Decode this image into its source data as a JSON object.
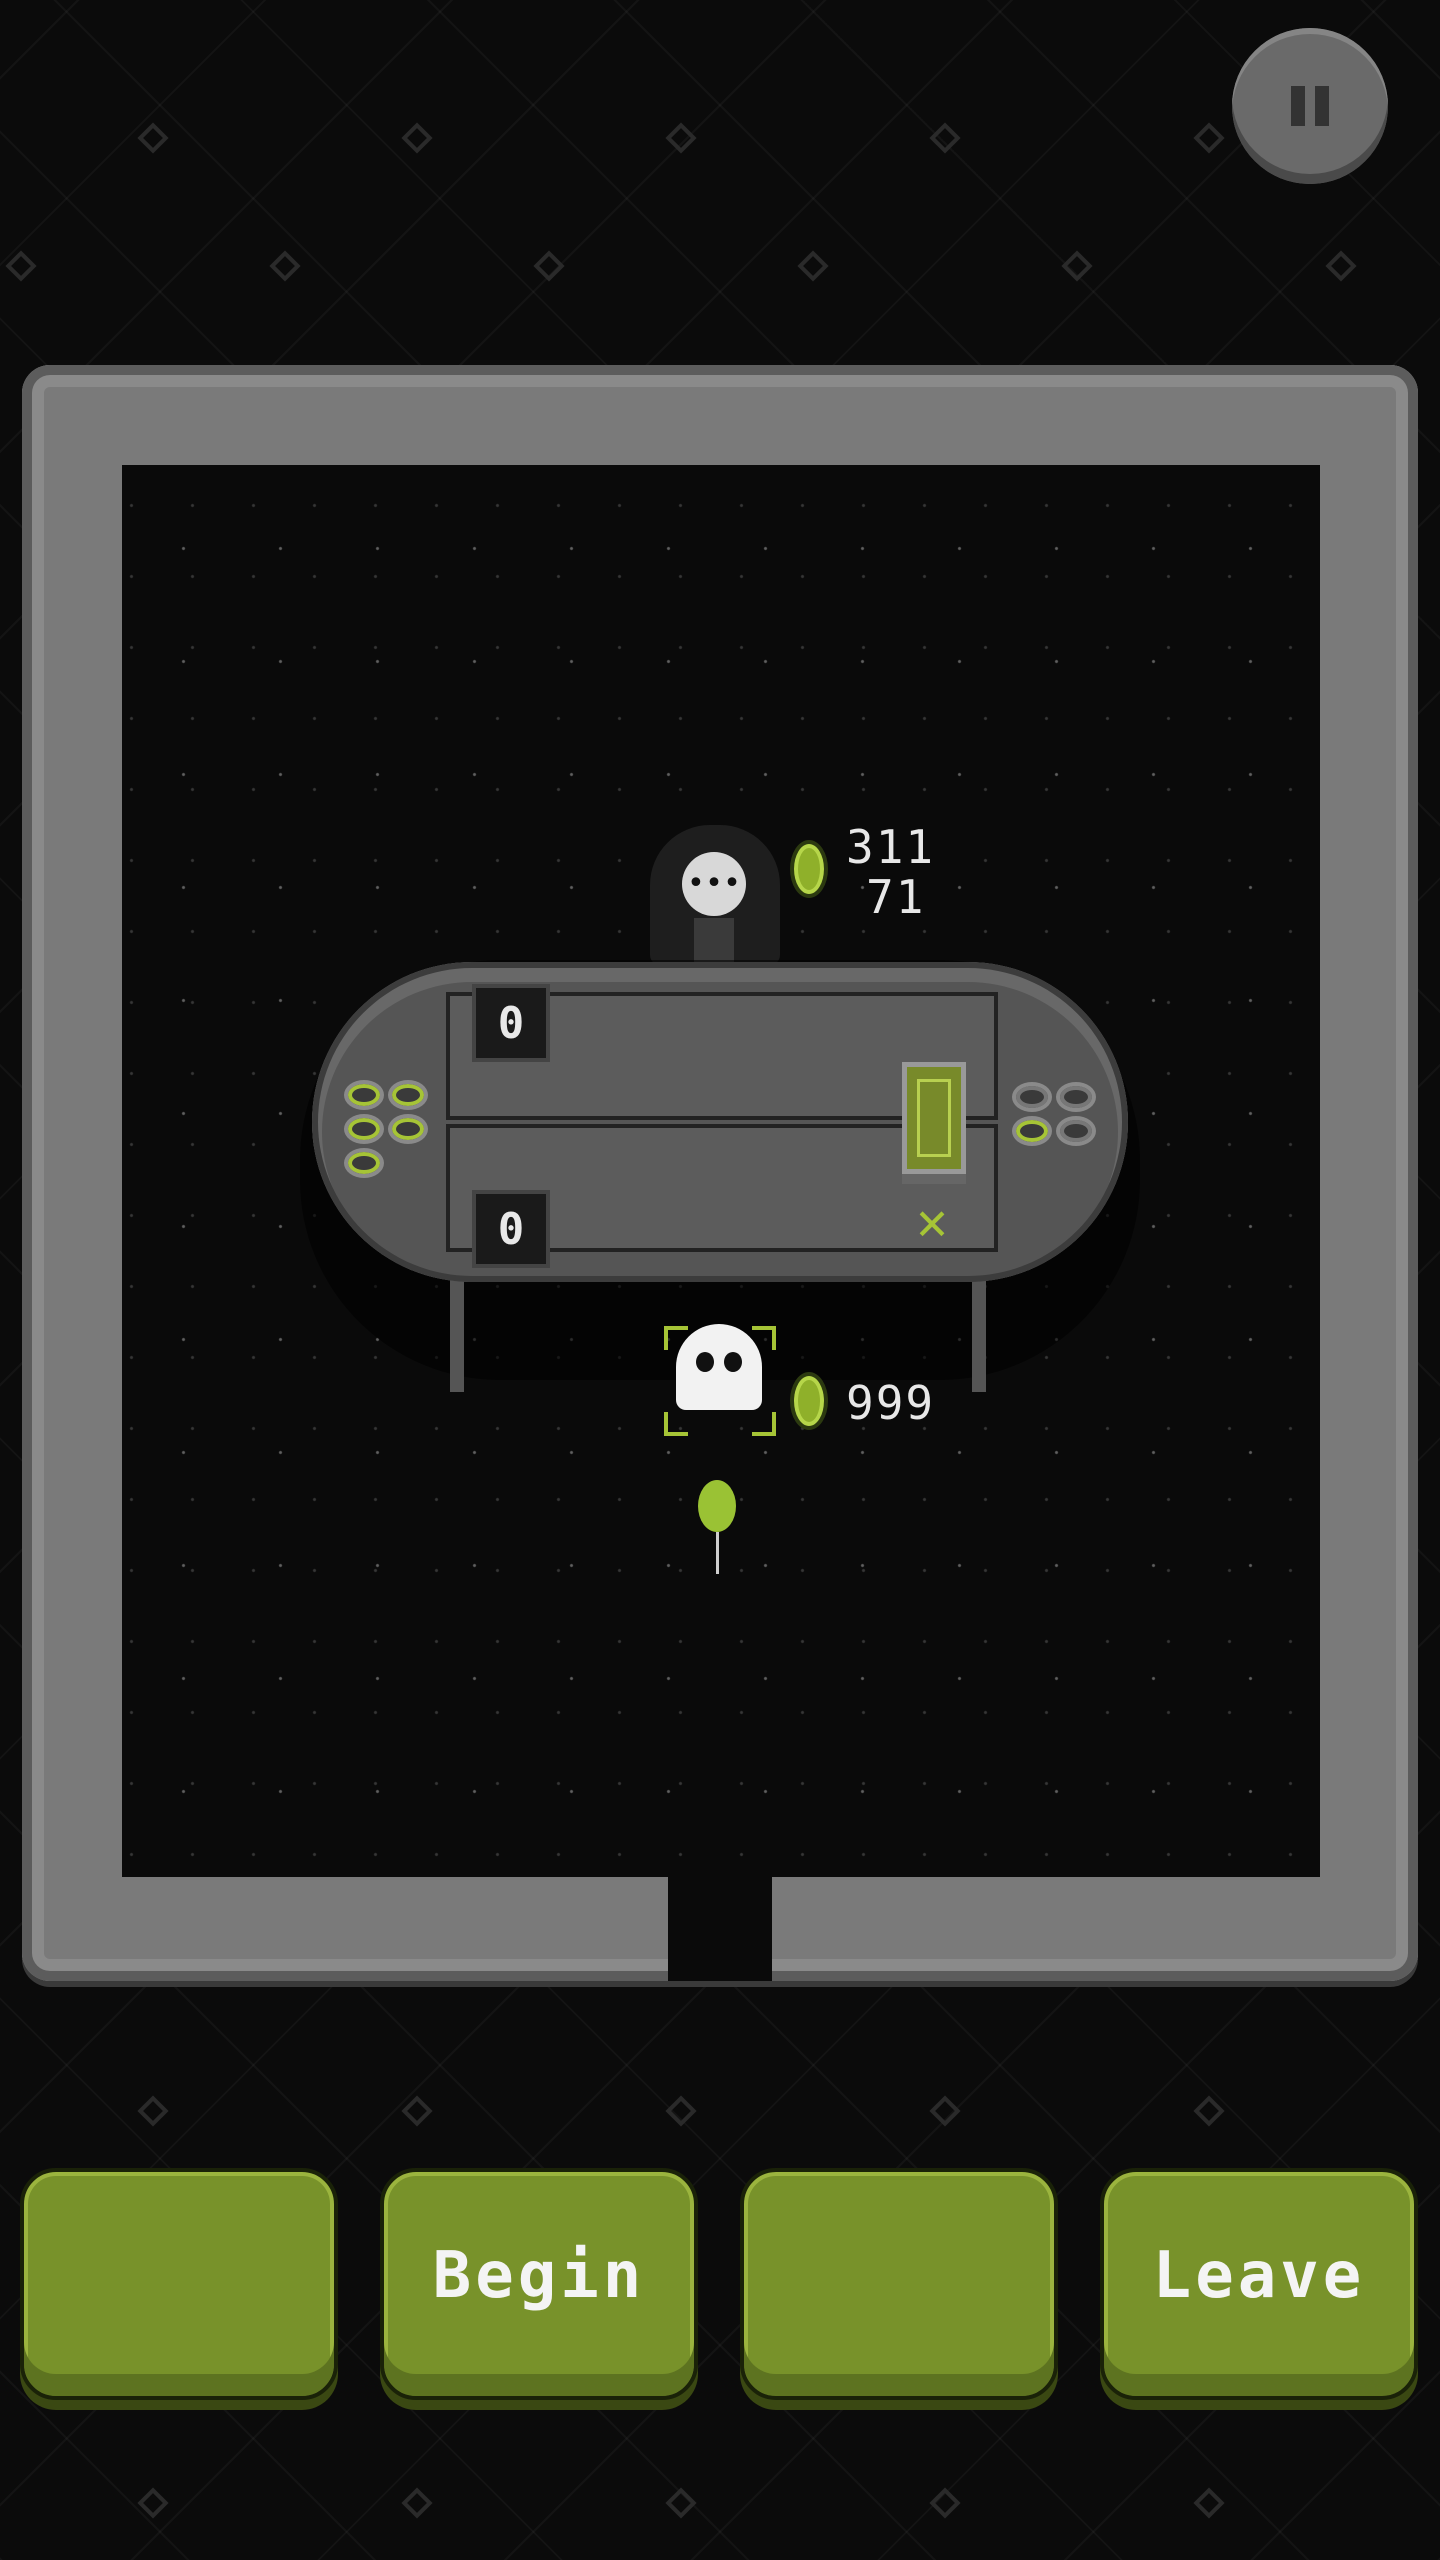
{
  "dealer": {
    "coins": "311",
    "bet": "71"
  },
  "player": {
    "coins": "999"
  },
  "table": {
    "dealer_score": "0",
    "player_score": "0"
  },
  "buttons": {
    "slot1_label": "",
    "begin_label": "Begin",
    "slot3_label": "",
    "leave_label": "Leave"
  },
  "icons": {
    "pause": "pause-icon",
    "coin": "green-gem-icon",
    "deck": "card-deck-icon",
    "discard": "crossed-cards-icon"
  },
  "colors": {
    "accent_green": "#78922a",
    "gem_green": "#8fb02a"
  }
}
